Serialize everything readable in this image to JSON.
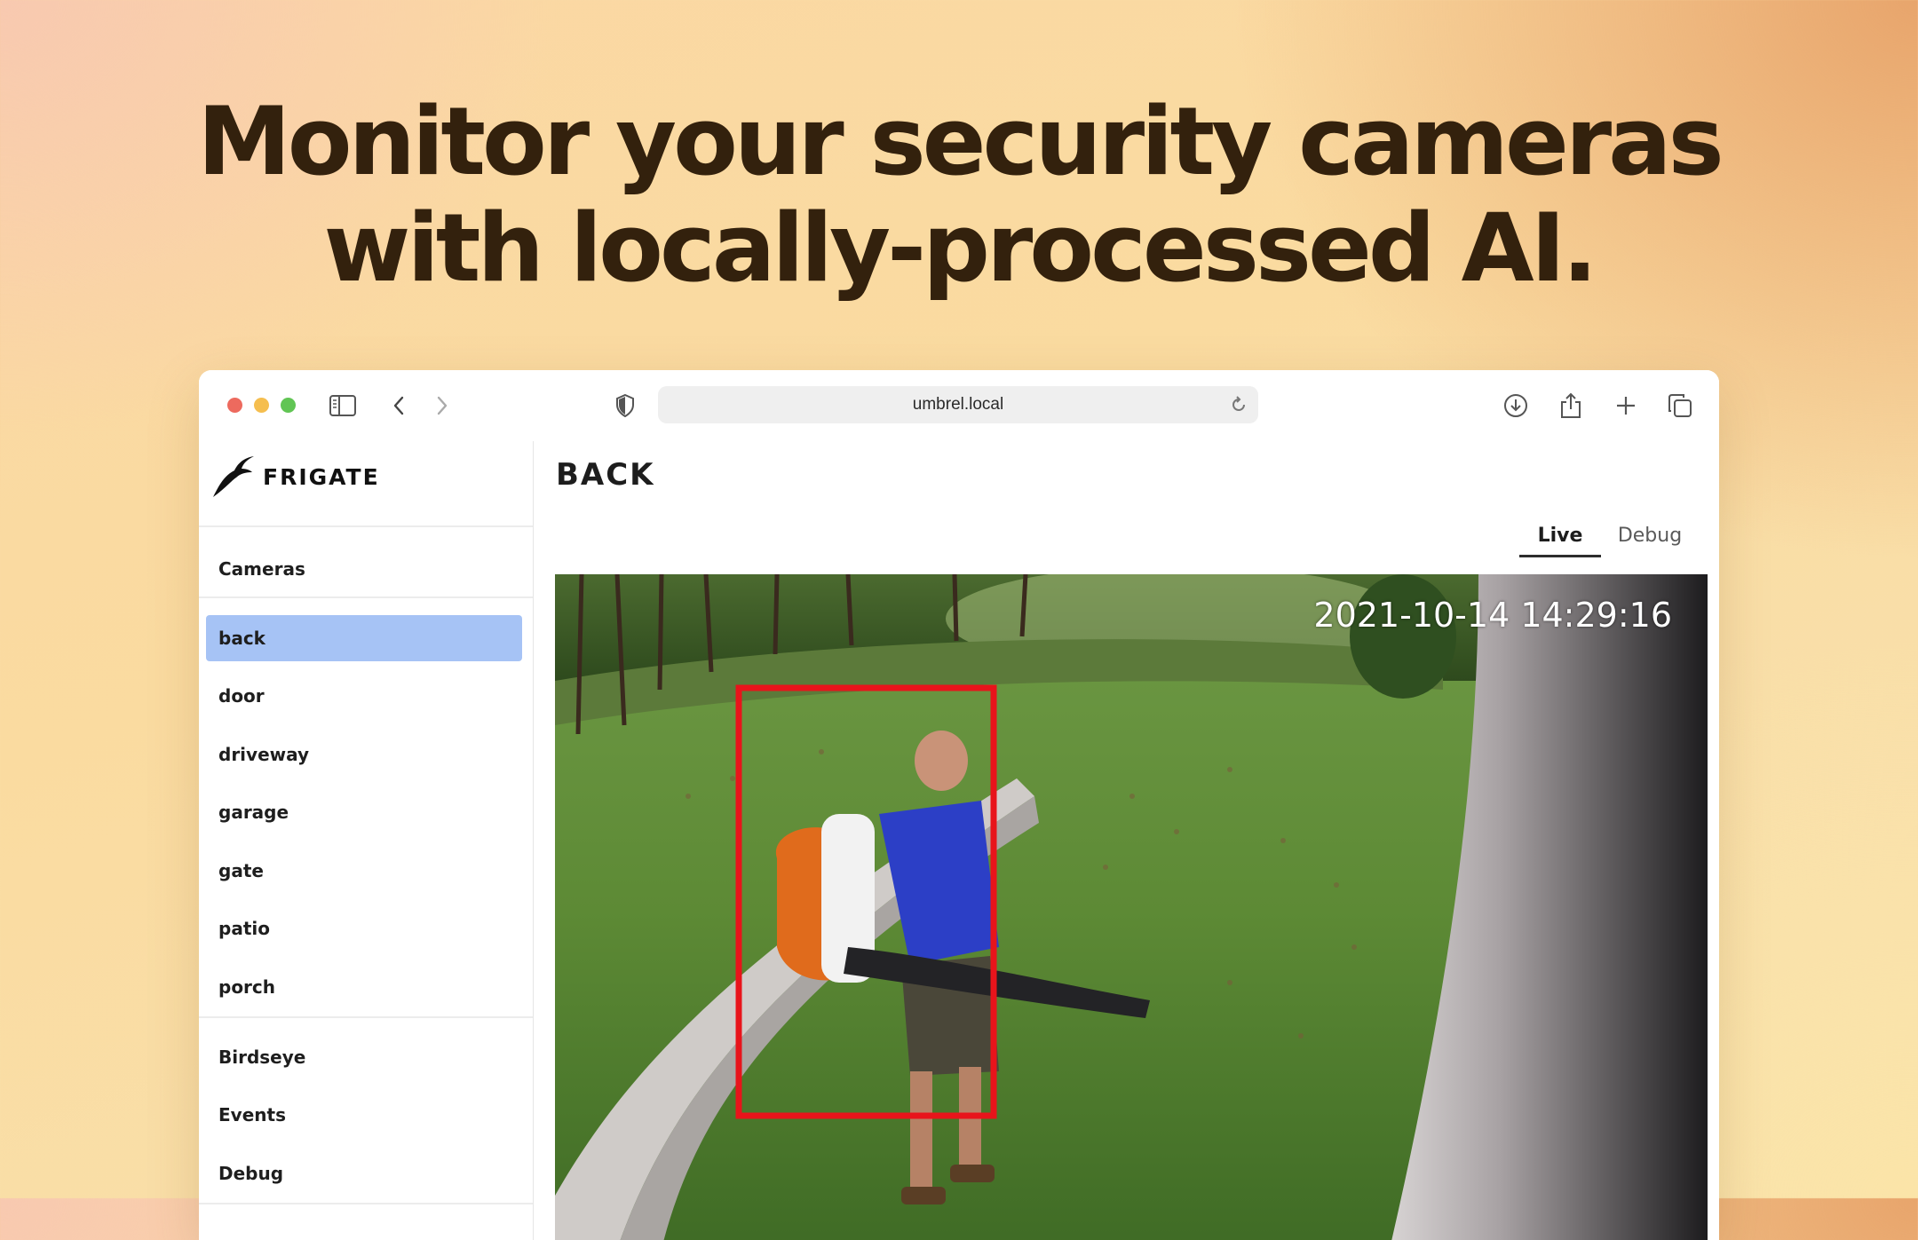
{
  "headline": {
    "line1": "Monitor your security cameras",
    "line2": "with locally-processed AI."
  },
  "browser": {
    "url": "umbrel.local",
    "icons": [
      "sidebar-toggle-icon",
      "back-arrow-icon",
      "forward-arrow-icon",
      "shield-icon",
      "reload-icon",
      "download-icon",
      "share-icon",
      "new-tab-icon",
      "tabs-overview-icon"
    ]
  },
  "sidebar": {
    "brand": "FRIGATE",
    "cameras_label": "Cameras",
    "cameras": [
      "back",
      "door",
      "driveway",
      "garage",
      "gate",
      "patio",
      "porch"
    ],
    "active_camera": "back",
    "links": [
      "Birdseye",
      "Events",
      "Debug"
    ]
  },
  "main": {
    "title": "BACK",
    "tabs": [
      "Live",
      "Debug"
    ],
    "active_tab": "Live",
    "timestamp": "2021-10-14 14:29:16",
    "detection_box_color": "#e8141b"
  },
  "colors": {
    "headline": "#33210d",
    "active_item_bg": "#a6c3f5"
  }
}
